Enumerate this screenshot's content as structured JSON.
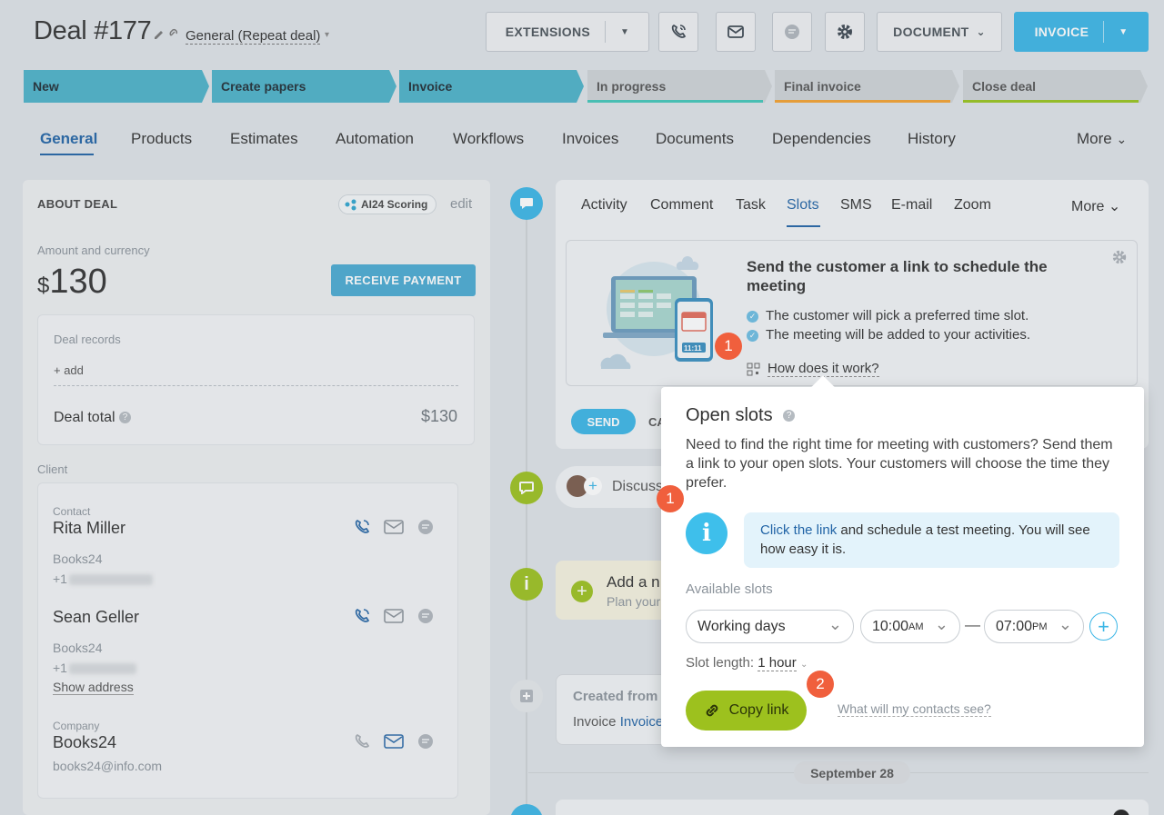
{
  "header": {
    "title": "Deal #177",
    "category": "General (Repeat deal)",
    "extensions_label": "EXTENSIONS",
    "document_label": "DOCUMENT",
    "invoice_label": "INVOICE"
  },
  "stages": [
    {
      "label": "New",
      "active": true,
      "bar": ""
    },
    {
      "label": "Create papers",
      "active": true,
      "bar": ""
    },
    {
      "label": "Invoice",
      "active": true,
      "bar": ""
    },
    {
      "label": "In progress",
      "active": false,
      "bar": "#43c7b9"
    },
    {
      "label": "Final invoice",
      "active": false,
      "bar": "#f4a12f"
    },
    {
      "label": "Close deal",
      "active": false,
      "bar": "#98c31c"
    }
  ],
  "tabs": [
    "General",
    "Products",
    "Estimates",
    "Automation",
    "Workflows",
    "Invoices",
    "Documents",
    "Dependencies",
    "History",
    "More"
  ],
  "about": {
    "heading": "ABOUT DEAL",
    "ai_badge": "AI24 Scoring",
    "edit": "edit",
    "amount_label": "Amount and currency",
    "currency": "$",
    "amount": "130",
    "receive_payment": "RECEIVE PAYMENT",
    "deal_records": "Deal records",
    "add": "+ add",
    "deal_total_label": "Deal total",
    "deal_total": "$130",
    "client_label": "Client",
    "contact_label": "Contact",
    "contact1_name": "Rita Miller",
    "contact1_company": "Books24",
    "contact1_phone": "+1",
    "contact2_name": "Sean Geller",
    "contact2_company": "Books24",
    "contact2_phone": "+1",
    "show_address": "Show address",
    "company_label": "Company",
    "company_name": "Books24",
    "company_email": "books24@info.com"
  },
  "activity_tabs": [
    "Activity",
    "Comment",
    "Task",
    "Slots",
    "SMS",
    "E-mail",
    "Zoom",
    "More"
  ],
  "slots_promo": {
    "title": "Send the customer a link to schedule the meeting",
    "point1": "The customer will pick a preferred time slot.",
    "point2": "The meeting will be added to your activities.",
    "how": "How does it work?",
    "phone_time": "11:11",
    "send": "SEND",
    "cancel": "CA"
  },
  "timeline": {
    "discuss": "Discuss",
    "add_new": "Add a n",
    "plan": "Plan your",
    "created_from": "Created from",
    "invoice_prefix": "Invoice",
    "invoice_link": "Invoice",
    "date": "September 28"
  },
  "popup": {
    "title": "Open slots",
    "description": "Need to find the right time for meeting with customers? Send them a link to your open slots. Your customers will choose the time they prefer.",
    "info_link": "Click the link",
    "info_text": " and schedule a test meeting. You will see how easy it is.",
    "available_slots": "Available slots",
    "days": "Working days",
    "from_time": "10:00",
    "from_ampm": "AM",
    "to_time": "07:00",
    "to_ampm": "PM",
    "dash": "—",
    "slot_length_label": "Slot length:",
    "slot_length_value": "1 hour",
    "copy_link": "Copy link",
    "contacts_see": "What will my contacts see?"
  },
  "badges": {
    "one": "1",
    "two": "2"
  },
  "colors": {
    "accent": "#3bb6e6",
    "link": "#2164a6",
    "green": "#9dc11e",
    "badge": "#f05f3d"
  }
}
